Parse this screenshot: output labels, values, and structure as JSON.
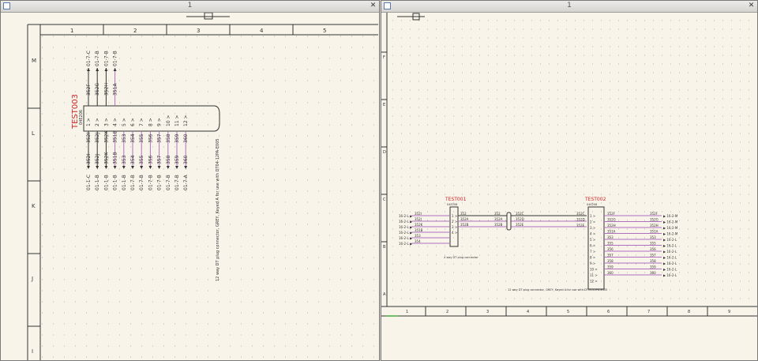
{
  "windows": [
    {
      "title": "1",
      "close_glyph": "✕",
      "columns": [
        "1",
        "2",
        "3",
        "4",
        "5"
      ],
      "rows": [
        "M",
        "L",
        "K",
        "J",
        "I"
      ],
      "connector": {
        "name": "TEST003",
        "part": "04E206",
        "description": "12 way DT plug connector, GREY, Keyed A for use with DT04-12PA-E005",
        "pins": [
          "1",
          "2",
          "3",
          "4",
          "5",
          "6",
          "7",
          "8",
          "9",
          "10",
          "11",
          "12"
        ],
        "top_wires": [
          "352F",
          "352G",
          "352H",
          "351A"
        ],
        "top_targets": [
          "01-7-C",
          "01-7-B",
          "01-7-B",
          "01-7-B"
        ],
        "bottom_wires": [
          "352I",
          "352J",
          "352K",
          "351B",
          "353",
          "354",
          "355",
          "356",
          "357",
          "358",
          "359",
          "360"
        ],
        "bottom_targets": [
          "01-1-C",
          "01-1-B",
          "01-1-B",
          "01-1-B",
          "01-1-B",
          "01-7-B",
          "01-7-B",
          "01-7-B",
          "01-7-B",
          "01-7-B",
          "01-7-B",
          "01-7-A"
        ]
      }
    },
    {
      "title": "1",
      "close_glyph": "✕",
      "columns": [
        "1",
        "2",
        "3",
        "4",
        "5",
        "6",
        "7",
        "8",
        "9"
      ],
      "rows": [
        "F",
        "E",
        "D",
        "C",
        "B",
        "A"
      ],
      "left_connector": {
        "name": "TEST001",
        "part": "04E206",
        "pins": [
          "1",
          "2",
          "3",
          "4"
        ],
        "in_labels": [
          "16-2-L",
          "16-2-L",
          "16-2-L",
          "16-2-L",
          "16-2-L",
          "16-2-L"
        ],
        "in_wires": [
          "352I",
          "352J",
          "352K",
          "351B",
          "353",
          "354"
        ],
        "out_wires": [
          "352",
          "352A",
          "352B",
          ""
        ],
        "note": "4 way DT plug connector"
      },
      "splice": {
        "wires": [
          "352",
          "352A",
          "352B"
        ],
        "out_wires": [
          "352C",
          "352D",
          "352E"
        ]
      },
      "right_connector": {
        "name": "TEST002",
        "part": "04E206",
        "pins": [
          "1",
          "2",
          "3",
          "4",
          "5",
          "6",
          "7",
          "8",
          "9",
          "10",
          "11",
          "12"
        ],
        "in_wires": [
          "352C",
          "352D",
          "352E",
          "",
          "",
          "",
          "",
          "",
          "",
          "",
          "",
          ""
        ],
        "out_wires": [
          "352F",
          "352G",
          "352H",
          "351A",
          "353",
          "355",
          "356",
          "357",
          "358",
          "359",
          "360",
          ""
        ],
        "out_labels": [
          "16-2-M",
          "16-2-M",
          "16-2-M",
          "16-2-M",
          "16-2-L",
          "16-2-L",
          "16-2-L",
          "16-2-L",
          "16-2-L",
          "16-2-L",
          "16-2-L",
          ""
        ],
        "note": "12 way DT plug connector, GREY, Keyed A for use with DT04-12PA-E005"
      }
    }
  ],
  "colors": {
    "wire": "#b070c0",
    "paper": "#f9f4ea",
    "frame": "#333333",
    "connector_name": "#cc2222"
  }
}
